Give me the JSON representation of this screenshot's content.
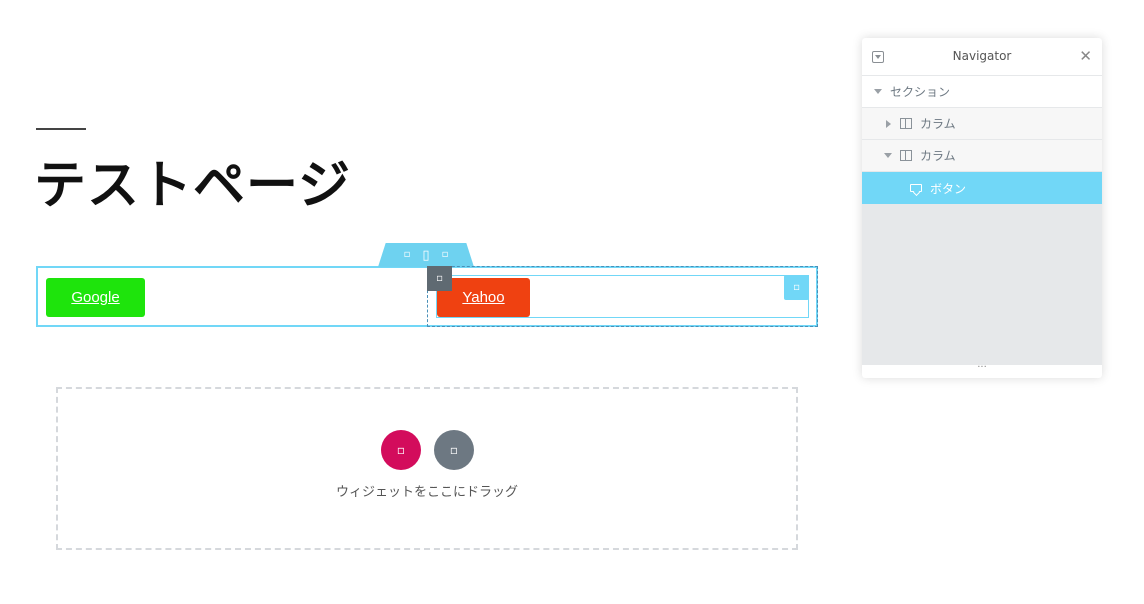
{
  "page": {
    "title": "テストページ"
  },
  "section": {
    "handle_icons": [
      "add-icon",
      "move-icon",
      "close-icon"
    ],
    "column_handle_icon": "column-icon",
    "widget_edit_icon": "pencil-icon",
    "buttons": [
      {
        "label": "Google",
        "color": "#1ee40c"
      },
      {
        "label": "Yahoo",
        "color": "#ef4111"
      }
    ]
  },
  "drop_zone": {
    "add_section_icon": "plus-icon",
    "add_template_icon": "folder-icon",
    "text": "ウィジェットをここにドラッグ"
  },
  "navigator": {
    "title": "Navigator",
    "items": [
      {
        "label": "セクション",
        "type": "section",
        "expanded": true
      },
      {
        "label": "カラム",
        "type": "column",
        "expanded": false
      },
      {
        "label": "カラム",
        "type": "column",
        "expanded": true
      },
      {
        "label": "ボタン",
        "type": "widget",
        "selected": true
      }
    ],
    "footer": "···"
  },
  "colors": {
    "accent": "#71d7f7",
    "pink": "#d30c5c",
    "gray": "#6d7882"
  }
}
